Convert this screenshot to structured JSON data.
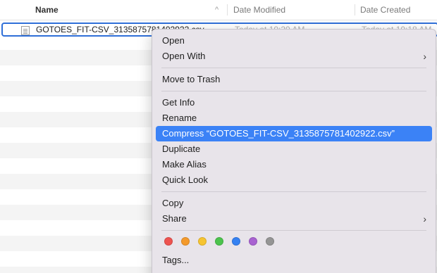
{
  "columns": {
    "name": "Name",
    "sort_indicator": "^",
    "date_modified": "Date Modified",
    "date_created": "Date Created"
  },
  "file": {
    "name": "GOTOES_FIT-CSV_3135875781402922.csv",
    "date_modified": "Today at 10:20 AM",
    "date_created": "Today at 10:18 AM"
  },
  "menu": {
    "open": "Open",
    "open_with": "Open With",
    "move_to_trash": "Move to Trash",
    "get_info": "Get Info",
    "rename": "Rename",
    "compress": "Compress “GOTOES_FIT-CSV_3135875781402922.csv”",
    "duplicate": "Duplicate",
    "make_alias": "Make Alias",
    "quick_look": "Quick Look",
    "copy": "Copy",
    "share": "Share",
    "tags": "Tags...",
    "submenu_chevron": "›"
  },
  "tag_colors": {
    "red": "#ee5350",
    "orange": "#f49a2c",
    "yellow": "#f6c431",
    "green": "#4cc34d",
    "blue": "#3581f2",
    "purple": "#a862d1",
    "gray": "#959595"
  },
  "highlight_color": "#3b82f6",
  "selection_border_color": "#2f6fd8"
}
